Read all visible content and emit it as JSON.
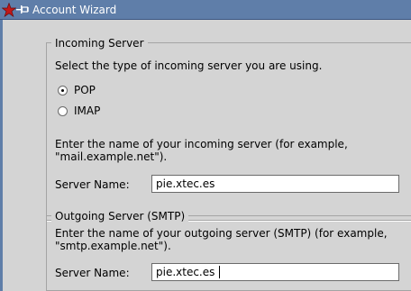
{
  "window": {
    "title": "Account Wizard"
  },
  "incoming": {
    "legend": "Incoming Server",
    "prompt": "Select the type of incoming server you are using.",
    "options": [
      {
        "label": "POP",
        "selected": true
      },
      {
        "label": "IMAP",
        "selected": false
      }
    ],
    "instructions_line1": "Enter the name of your incoming server (for example,",
    "instructions_line2": "\"mail.example.net\").",
    "server_label": "Server Name:",
    "server_value": "pie.xtec.es"
  },
  "outgoing": {
    "legend": "Outgoing Server (SMTP)",
    "instructions_line1": "Enter the name of your outgoing server (SMTP) (for example,",
    "instructions_line2": "\"smtp.example.net\").",
    "server_label": "Server Name:",
    "server_value": "pie.xtec.es"
  },
  "colors": {
    "titlebar": "#5f7ea9",
    "background": "#d4d4d4",
    "star": "#c21818"
  }
}
